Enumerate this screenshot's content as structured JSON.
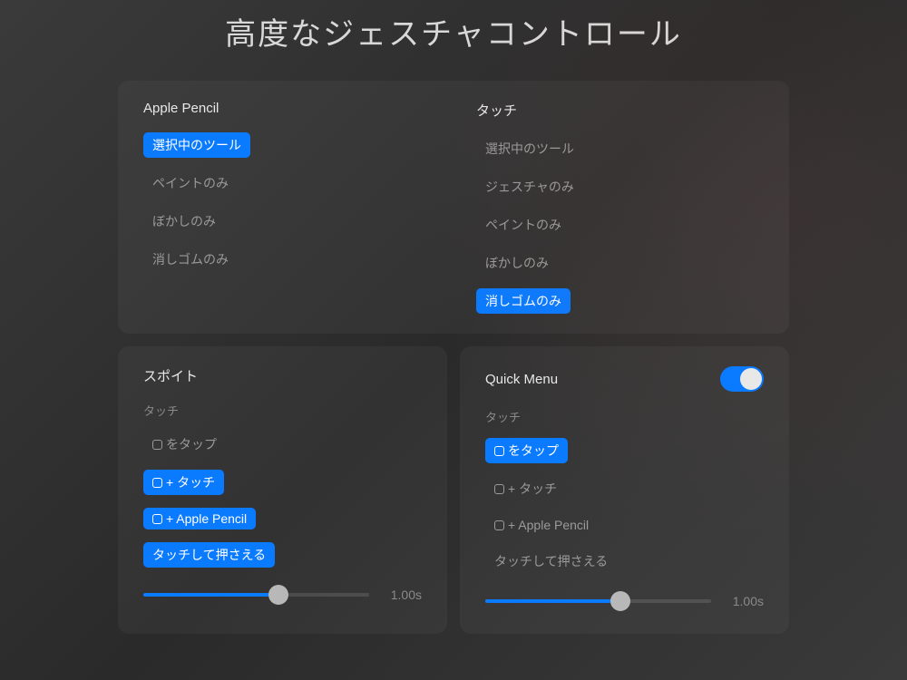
{
  "title": "高度なジェスチャコントロール",
  "topPanel": {
    "left": {
      "heading": "Apple Pencil",
      "options": [
        {
          "label": "選択中のツール",
          "selected": true
        },
        {
          "label": "ペイントのみ",
          "selected": false
        },
        {
          "label": "ぼかしのみ",
          "selected": false
        },
        {
          "label": "消しゴムのみ",
          "selected": false
        }
      ]
    },
    "right": {
      "heading": "タッチ",
      "options": [
        {
          "label": "選択中のツール",
          "selected": false
        },
        {
          "label": "ジェスチャのみ",
          "selected": false
        },
        {
          "label": "ペイントのみ",
          "selected": false
        },
        {
          "label": "ぼかしのみ",
          "selected": false
        },
        {
          "label": "消しゴムのみ",
          "selected": true
        }
      ]
    }
  },
  "eyedropper": {
    "heading": "スポイト",
    "subLabel": "タッチ",
    "options": [
      {
        "label": "をタップ",
        "icon": true,
        "selected": false
      },
      {
        "label": "+ タッチ",
        "icon": true,
        "selected": true
      },
      {
        "label": "+ Apple Pencil",
        "icon": true,
        "selected": true
      },
      {
        "label": "タッチして押さえる",
        "icon": false,
        "selected": true
      }
    ],
    "sliderValue": "1.00s",
    "sliderPercent": 60
  },
  "quickMenu": {
    "heading": "Quick Menu",
    "toggleOn": true,
    "subLabel": "タッチ",
    "options": [
      {
        "label": "をタップ",
        "icon": true,
        "selected": true
      },
      {
        "label": "+ タッチ",
        "icon": true,
        "selected": false
      },
      {
        "label": "+ Apple Pencil",
        "icon": true,
        "selected": false
      },
      {
        "label": "タッチして押さえる",
        "icon": false,
        "selected": false
      }
    ],
    "sliderValue": "1.00s",
    "sliderPercent": 60
  }
}
